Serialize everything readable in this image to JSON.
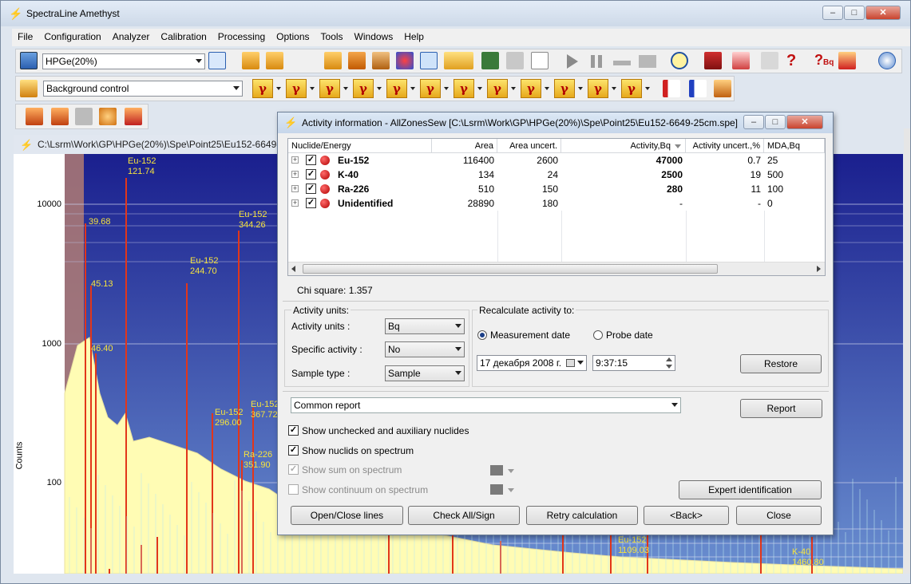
{
  "app": {
    "title": "SpectraLine Amethyst"
  },
  "menu": [
    "File",
    "Configuration",
    "Analyzer",
    "Calibration",
    "Processing",
    "Options",
    "Tools",
    "Windows",
    "Help"
  ],
  "toolbar": {
    "detector": "HPGe(20%)",
    "control": "Background control"
  },
  "spectrum": {
    "path": "C:\\Lsrm\\Work\\GP\\HPGe(20%)\\Spe\\Point25\\Eu152-6649-",
    "ylabel": "Counts",
    "yticks": [
      "10000",
      "1000",
      "100"
    ],
    "peaks": [
      {
        "nuclide": "Eu-152",
        "energy": "121.74"
      },
      {
        "nuclide": "",
        "energy": "39.68"
      },
      {
        "nuclide": "Eu-152",
        "energy": "344.26"
      },
      {
        "nuclide": "Eu-152",
        "energy": "244.70"
      },
      {
        "nuclide": "",
        "energy": "45.13"
      },
      {
        "nuclide": "",
        "energy": "46.40"
      },
      {
        "nuclide": "Eu-152",
        "energy": "296.00"
      },
      {
        "nuclide": "Eu-152",
        "energy": "367.72"
      },
      {
        "nuclide": "Ra-226",
        "energy": "351.90"
      },
      {
        "nuclide": "Eu-152",
        "energy": "1109.03"
      },
      {
        "nuclide": "K-40",
        "energy": "1460.80"
      }
    ]
  },
  "dialog": {
    "title": "Activity information - AllZonesSew  [C:\\Lsrm\\Work\\GP\\HPGe(20%)\\Spe\\Point25\\Eu152-6649-25cm.spe]",
    "columns": [
      "Nuclide/Energy",
      "Area",
      "Area uncert.",
      "Activity,Bq",
      "Activity uncert.,%",
      "MDA,Bq"
    ],
    "rows": [
      {
        "name": "Eu-152",
        "area": "116400",
        "area_unc": "2600",
        "activity": "47000",
        "act_unc": "0.7",
        "mda": "25"
      },
      {
        "name": "K-40",
        "area": "134",
        "area_unc": "24",
        "activity": "2500",
        "act_unc": "19",
        "mda": "500"
      },
      {
        "name": "Ra-226",
        "area": "510",
        "area_unc": "150",
        "activity": "280",
        "act_unc": "11",
        "mda": "100"
      },
      {
        "name": "Unidentified",
        "area": "28890",
        "area_unc": "180",
        "activity": "-",
        "act_unc": "-",
        "mda": "0"
      }
    ],
    "chi_square": "Chi square: 1.357",
    "activity_units_group": "Activity units:",
    "activity_units_label": "Activity units :",
    "activity_units_value": "Bq",
    "specific_activity_label": "Specific activity :",
    "specific_activity_value": "No",
    "sample_type_label": "Sample type :",
    "sample_type_value": "Sample",
    "recalc_group": "Recalculate activity to:",
    "measurement_date": "Measurement date",
    "probe_date": "Probe date",
    "date_value": "17 декабря  2008 г.",
    "time_value": "9:37:15",
    "restore": "Restore",
    "report_type": "Common report",
    "report": "Report",
    "show_unchecked": "Show unchecked and auxiliary nuclides",
    "show_nuclids": "Show nuclids on spectrum",
    "show_sum": "Show sum on spectrum",
    "show_continuum": "Show continuum on spectrum",
    "expert": "Expert identification",
    "open_close": "Open/Close lines",
    "check_all": "Check All/Sign",
    "retry": "Retry calculation",
    "back": "<Back>",
    "close": "Close"
  }
}
